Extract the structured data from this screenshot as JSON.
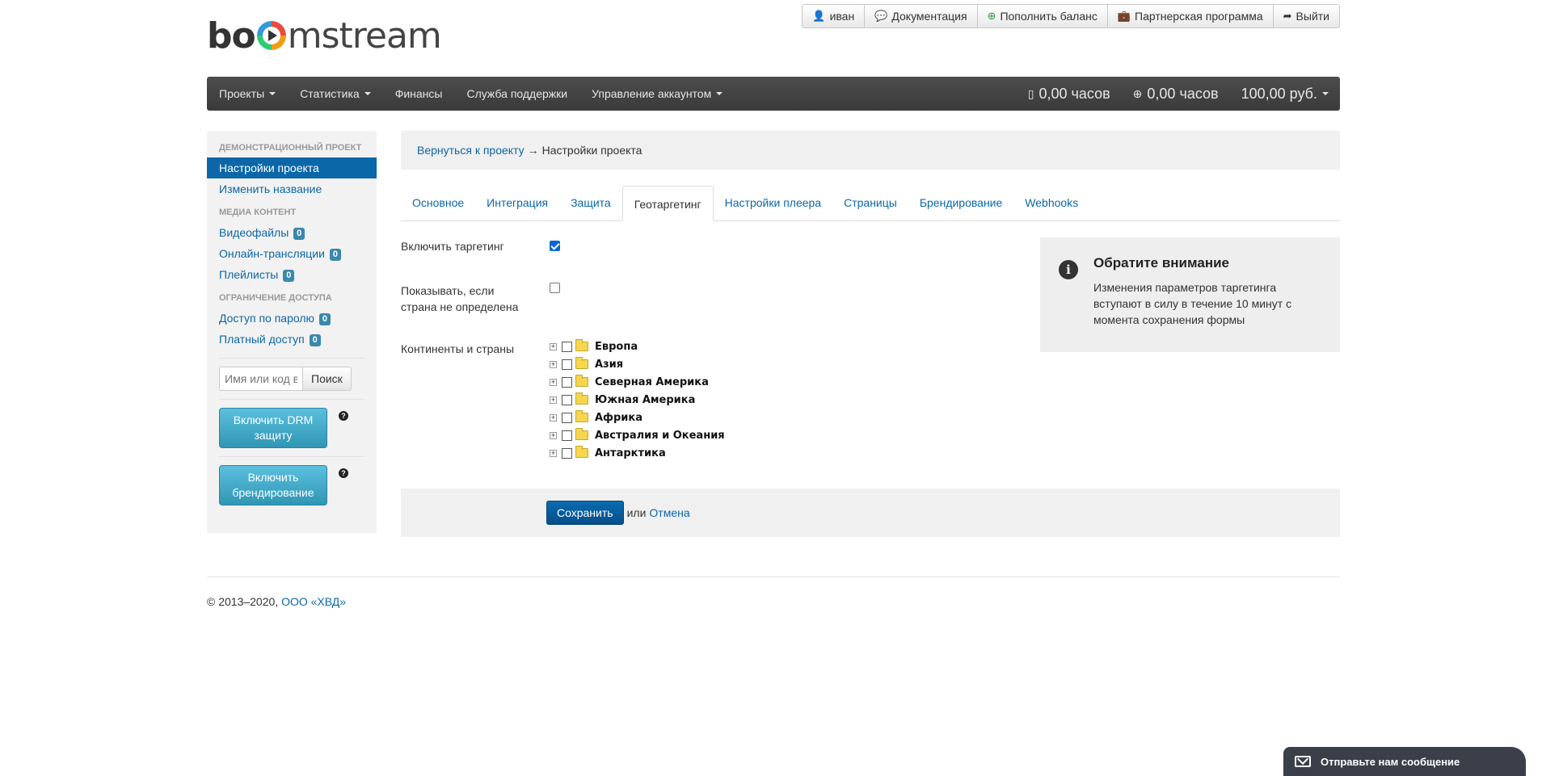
{
  "logo": {
    "left": "bo",
    "right": "mstream"
  },
  "userbar": [
    {
      "icon": "user-icon",
      "glyph": "👤",
      "label": "иван"
    },
    {
      "icon": "comment-icon",
      "glyph": "💬",
      "label": "Документация"
    },
    {
      "icon": "plus-circle-icon",
      "glyph": "⊕",
      "label": "Пополнить баланс"
    },
    {
      "icon": "briefcase-icon",
      "glyph": "💼",
      "label": "Партнерская программа"
    },
    {
      "icon": "share-icon",
      "glyph": "➦",
      "label": "Выйти"
    }
  ],
  "navbar": {
    "items": [
      {
        "label": "Проекты",
        "dropdown": true
      },
      {
        "label": "Статистика",
        "dropdown": true
      },
      {
        "label": "Финансы",
        "dropdown": false
      },
      {
        "label": "Служба поддержки",
        "dropdown": false
      },
      {
        "label": "Управление аккаунтом",
        "dropdown": true
      }
    ],
    "stats": [
      {
        "icon": "mobile-icon",
        "glyph": "▯",
        "value": "0,00 часов"
      },
      {
        "icon": "globe-icon",
        "glyph": "⊕",
        "value": "0,00 часов"
      }
    ],
    "balance": "100,00 руб."
  },
  "sidebar": {
    "sections": [
      {
        "header": "ДЕМОНСТРАЦИОННЫЙ ПРОЕКТ",
        "items": [
          {
            "label": "Настройки проекта",
            "active": true
          },
          {
            "label": "Изменить название",
            "active": false
          }
        ]
      },
      {
        "header": "МЕДИА КОНТЕНТ",
        "items": [
          {
            "label": "Видеофайлы",
            "badge": "0"
          },
          {
            "label": "Онлайн-трансляции",
            "badge": "0"
          },
          {
            "label": "Плейлисты",
            "badge": "0"
          }
        ]
      },
      {
        "header": "ОГРАНИЧЕНИЕ ДОСТУПА",
        "items": [
          {
            "label": "Доступ по паролю",
            "badge": "0"
          },
          {
            "label": "Платный доступ",
            "badge": "0"
          }
        ]
      }
    ],
    "search": {
      "placeholder": "Имя или код в",
      "button": "Поиск"
    },
    "drm_button": "Включить DRM защиту",
    "branding_button": "Включить брендирование",
    "help_glyph": "?"
  },
  "breadcrumb": {
    "back": "Вернуться к проекту",
    "sep": "→",
    "current": "Настройки проекта"
  },
  "tabs": [
    {
      "label": "Основное",
      "active": false
    },
    {
      "label": "Интеграция",
      "active": false
    },
    {
      "label": "Защита",
      "active": false
    },
    {
      "label": "Геотаргетинг",
      "active": true
    },
    {
      "label": "Настройки плеера",
      "active": false
    },
    {
      "label": "Страницы",
      "active": false
    },
    {
      "label": "Брендирование",
      "active": false
    },
    {
      "label": "Webhooks",
      "active": false
    }
  ],
  "form": {
    "enable_label": "Включить таргетинг",
    "enable_checked": true,
    "unknown_label_1": "Показывать, если",
    "unknown_label_2": "страна не определена",
    "unknown_checked": false,
    "continents_label": "Континенты и страны",
    "continents": [
      "Европа",
      "Азия",
      "Северная Америка",
      "Южная Америка",
      "Африка",
      "Австралия и Океания",
      "Антарктика"
    ],
    "expander_glyph": "+"
  },
  "notice": {
    "glyph": "i",
    "title": "Обратите внимание",
    "text": "Изменения параметров таргетинга вступают в силу в течение 10 минут с момента сохранения формы"
  },
  "actions": {
    "save": "Сохранить",
    "or": "или",
    "cancel": "Отмена"
  },
  "footer": {
    "copyright": "© 2013–2020,",
    "company": "ООО «ХВД»"
  },
  "chat": {
    "label": "Отправьте нам сообщение"
  },
  "colors": {
    "accent": "#0b67a8",
    "navbar": "#444444",
    "info_button": "#49afcd",
    "badge": "#3a87ad"
  }
}
